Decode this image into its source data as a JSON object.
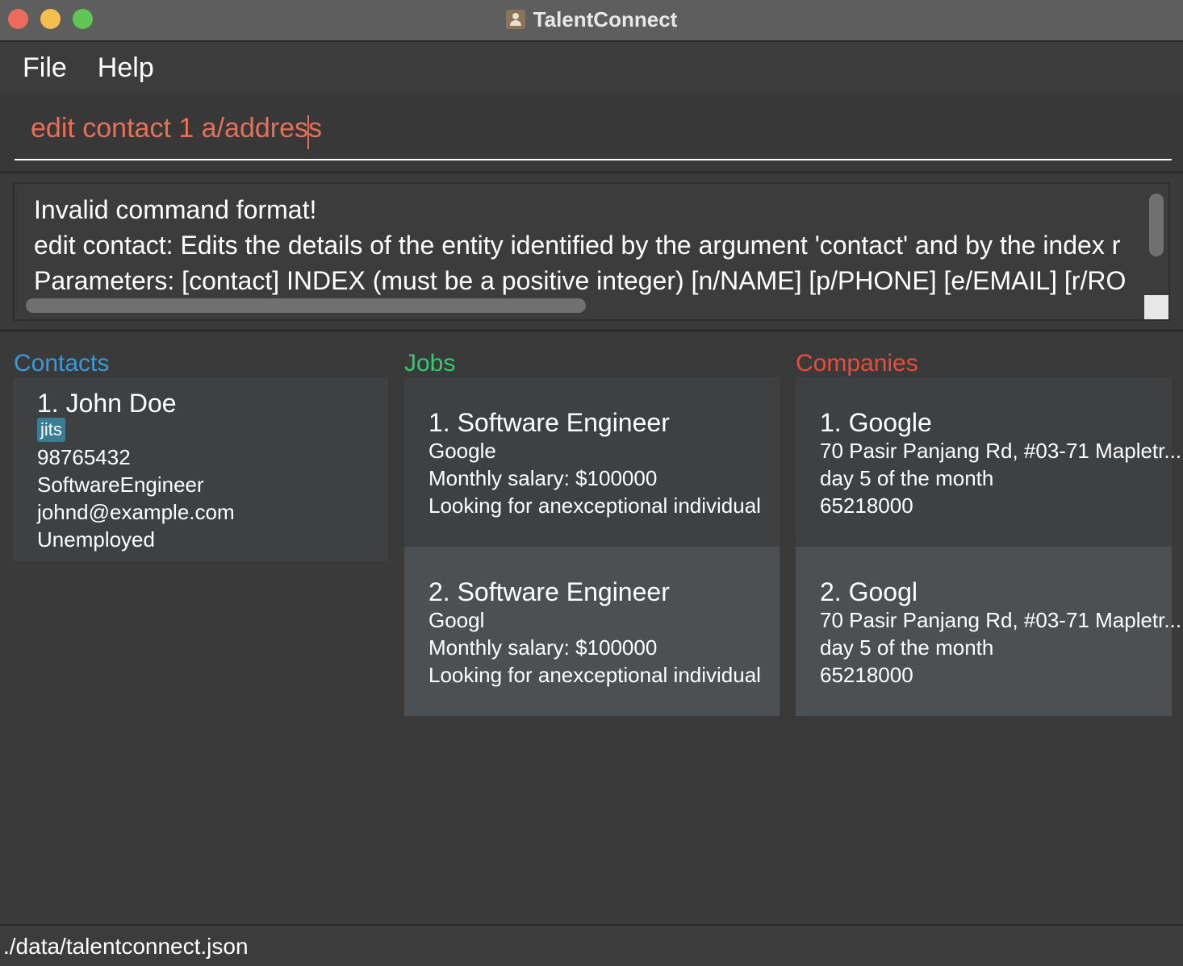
{
  "window": {
    "title": "TalentConnect"
  },
  "menu": {
    "file": "File",
    "help": "Help"
  },
  "command": {
    "value": "edit contact 1 a/address"
  },
  "result": {
    "lines": [
      "Invalid command format!",
      "edit contact: Edits the details of the entity identified by the argument 'contact' and by the index r",
      "Parameters: [contact] INDEX (must be a positive integer) [n/NAME] [p/PHONE] [e/EMAIL] [r/RO"
    ]
  },
  "panels": {
    "contacts": "Contacts",
    "jobs": "Jobs",
    "companies": "Companies"
  },
  "contacts": [
    {
      "title": "1. John Doe",
      "tag": "jits",
      "phone": "98765432",
      "role": "SoftwareEngineer",
      "email": "johnd@example.com",
      "status": "Unemployed"
    }
  ],
  "jobs": [
    {
      "title": "1. Software Engineer",
      "company": "Google",
      "salary": "Monthly salary: $100000",
      "description": "Looking for anexceptional individual"
    },
    {
      "title": "2. Software Engineer",
      "company": "Googl",
      "salary": "Monthly salary: $100000",
      "description": "Looking for anexceptional individual"
    }
  ],
  "companies": [
    {
      "title": "1. Google",
      "address": "70 Pasir Panjang Rd, #03-71 Mapletr...",
      "billing": "day 5 of the month",
      "phone": "65218000"
    },
    {
      "title": "2. Googl",
      "address": "70 Pasir Panjang Rd, #03-71 Mapletr...",
      "billing": "day 5 of the month",
      "phone": "65218000"
    }
  ],
  "status": {
    "path": "./data/talentconnect.json"
  }
}
